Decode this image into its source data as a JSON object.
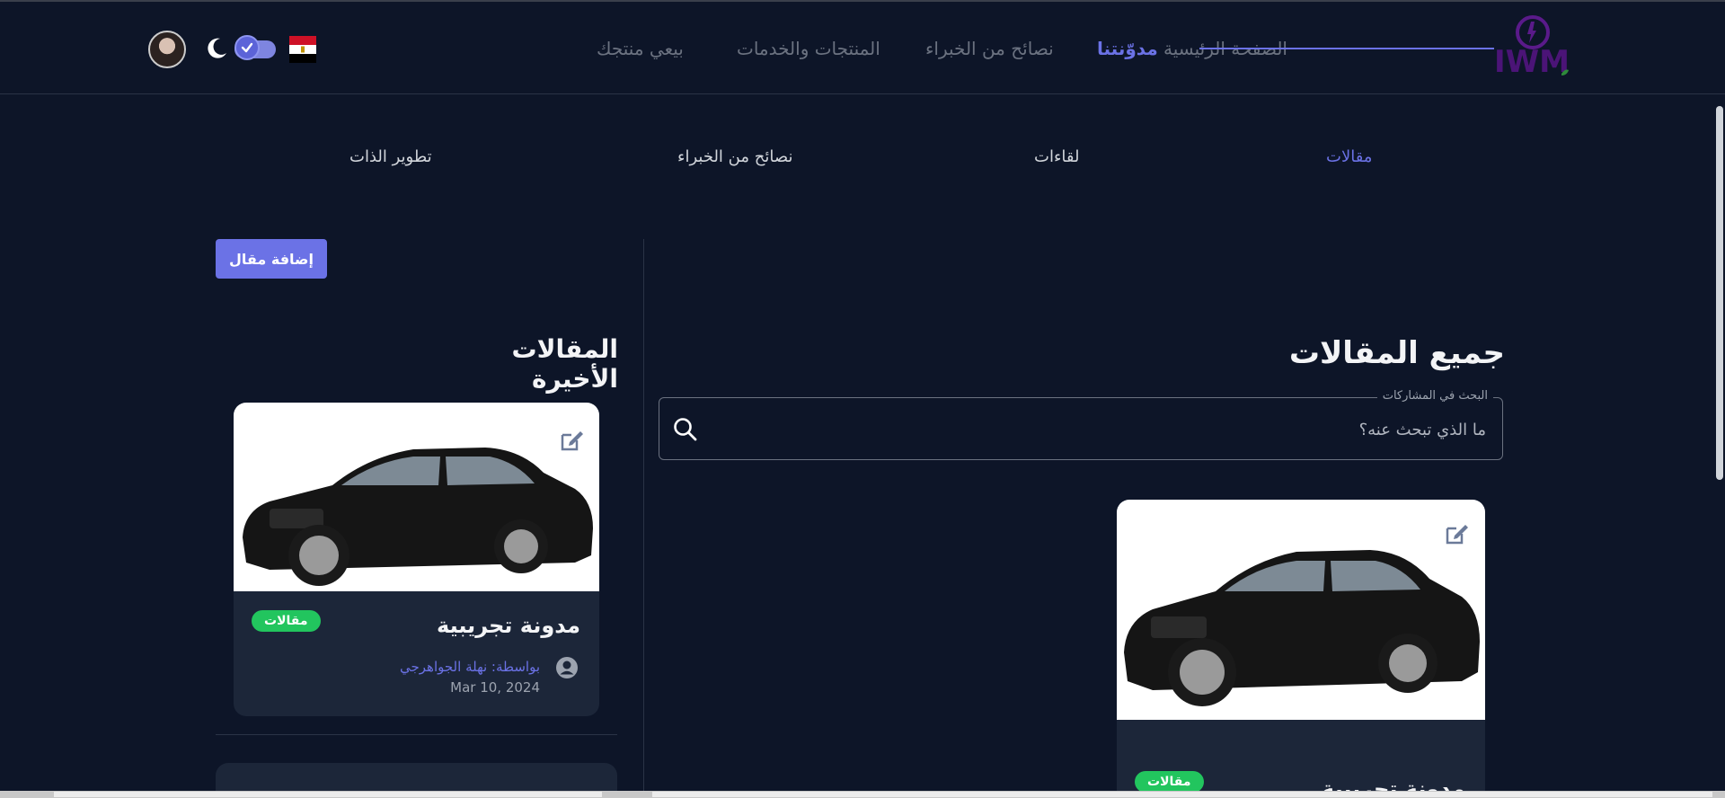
{
  "nav": {
    "logo_text": "IWM",
    "links": [
      {
        "label": "الصفحة الرئيسية",
        "active": false
      },
      {
        "label": "مدوّنتنا",
        "active": true
      },
      {
        "label": "نصائح من الخبراء",
        "active": false
      },
      {
        "label": "المنتجات والخدمات",
        "active": false
      },
      {
        "label": "بيعي منتجك",
        "active": false
      }
    ]
  },
  "tabs": [
    {
      "label": "مقالات",
      "active": true
    },
    {
      "label": "لقاءات",
      "active": false
    },
    {
      "label": "نصائح من الخبراء",
      "active": false
    },
    {
      "label": "تطوير الذات",
      "active": false
    }
  ],
  "sidebar": {
    "add_button": "إضافة مقال",
    "recent_title": "المقالات الأخيرة",
    "recent_card": {
      "title": "مدونة تجريبية",
      "badge": "مقالات",
      "author": "بواسطة: نهلة الجواهرجي",
      "date": "Mar 10, 2024"
    }
  },
  "main": {
    "title": "جميع المقالات",
    "search": {
      "label": "البحث في المشاركات",
      "placeholder": "ما الذي تبحث عنه؟"
    },
    "card": {
      "title": "مدونة تجريبية",
      "badge": "مقالات"
    }
  },
  "colors": {
    "background": "#0d1528",
    "accent": "#6b72e6",
    "card": "#1c2639",
    "badge": "#22c55e"
  }
}
